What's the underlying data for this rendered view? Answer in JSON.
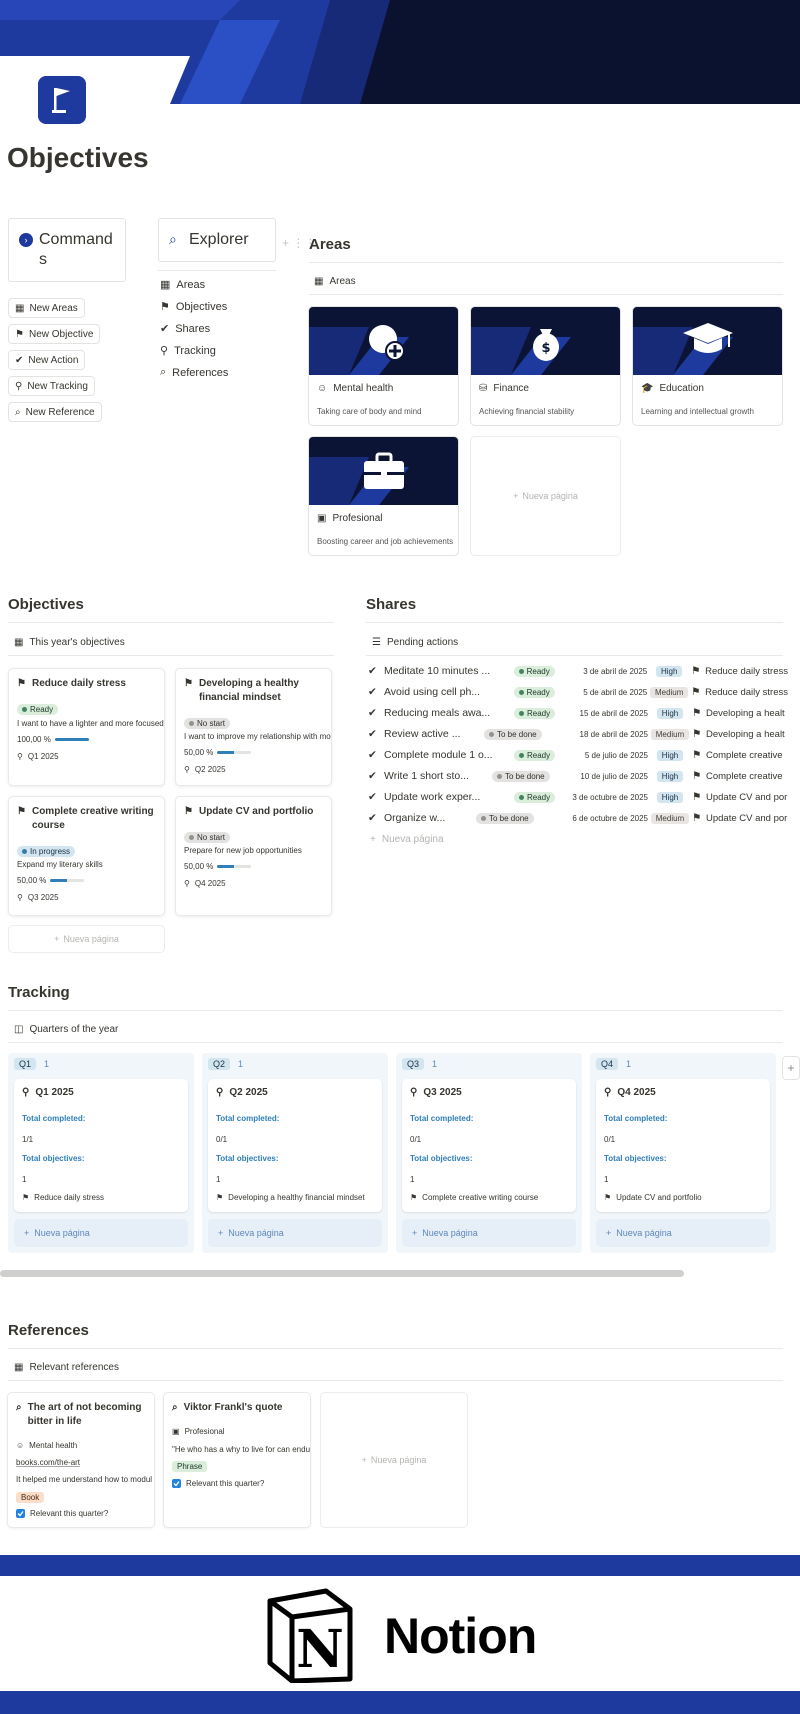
{
  "page": {
    "title": "Objectives"
  },
  "sidebar": {
    "commands_title": "Commands",
    "buttons": [
      {
        "label": "New Areas"
      },
      {
        "label": "New Objective"
      },
      {
        "label": "New Action"
      },
      {
        "label": "New Tracking"
      },
      {
        "label": "New Reference"
      }
    ],
    "explorer_title": "Explorer",
    "nav": [
      {
        "label": "Areas"
      },
      {
        "label": "Objectives"
      },
      {
        "label": "Shares"
      },
      {
        "label": "Tracking"
      },
      {
        "label": "References"
      }
    ]
  },
  "areas": {
    "heading": "Areas",
    "view": "Areas",
    "new_page": "Nueva página",
    "cards": [
      {
        "title": "Mental health",
        "desc": "Taking care of body and mind"
      },
      {
        "title": "Finance",
        "desc": "Achieving financial stability"
      },
      {
        "title": "Education",
        "desc": "Learning and intellectual growth"
      },
      {
        "title": "Profesional",
        "desc": "Boosting career and job achievements"
      }
    ]
  },
  "objectives": {
    "heading": "Objectives",
    "view": "This year's objectives",
    "new_page": "Nueva página",
    "cards": [
      {
        "title": "Reduce daily stress",
        "status": "Ready",
        "desc": "I want to have a lighter and more focused",
        "progress": "100,00 %",
        "progress_value": 1.0,
        "quarter": "Q1 2025"
      },
      {
        "title": "Developing a healthy financial mindset",
        "status": "No start",
        "desc": "I want to improve my relationship with mo",
        "progress": "50,00 %",
        "progress_value": 0.5,
        "quarter": "Q2 2025"
      },
      {
        "title": "Complete creative writing course",
        "status": "In progress",
        "desc": "Expand my literary skills",
        "progress": "50,00 %",
        "progress_value": 0.5,
        "quarter": "Q3 2025"
      },
      {
        "title": "Update CV and portfolio",
        "status": "No start",
        "desc": "Prepare for new job opportunities",
        "progress": "50,00 %",
        "progress_value": 0.5,
        "quarter": "Q4 2025"
      }
    ]
  },
  "shares": {
    "heading": "Shares",
    "view": "Pending actions",
    "new_page": "Nueva página",
    "rows": [
      {
        "name": "Meditate 10 minutes ...",
        "status": "Ready",
        "date": "3 de abril de 2025",
        "priority": "High",
        "objective": "Reduce daily stress"
      },
      {
        "name": "Avoid using cell ph...",
        "status": "Ready",
        "date": "5 de abril de 2025",
        "priority": "Medium",
        "objective": "Reduce daily stress"
      },
      {
        "name": "Reducing meals awa...",
        "status": "Ready",
        "date": "15 de abril de 2025",
        "priority": "High",
        "objective": "Developing a healt"
      },
      {
        "name": "Review active ...",
        "status": "To be done",
        "date": "18 de abril de 2025",
        "priority": "Medium",
        "objective": "Developing a healt"
      },
      {
        "name": "Complete module 1 o...",
        "status": "Ready",
        "date": "5 de julio de 2025",
        "priority": "High",
        "objective": "Complete creative"
      },
      {
        "name": "Write 1 short sto...",
        "status": "To be done",
        "date": "10 de julio de 2025",
        "priority": "High",
        "objective": "Complete creative"
      },
      {
        "name": "Update work exper...",
        "status": "Ready",
        "date": "3 de octubre de 2025",
        "priority": "High",
        "objective": "Update CV and por"
      },
      {
        "name": "Organize w...",
        "status": "To be done",
        "date": "6 de octubre de 2025",
        "priority": "Medium",
        "objective": "Update CV and por"
      }
    ]
  },
  "tracking": {
    "heading": "Tracking",
    "view": "Quarters of the year",
    "completed_label": "Total completed:",
    "objectives_label": "Total objectives:",
    "new_page": "Nueva página",
    "columns": [
      {
        "group": "Q1",
        "count": "1",
        "title": "Q1 2025",
        "completed": "1/1",
        "total": "1",
        "objective": "Reduce daily stress"
      },
      {
        "group": "Q2",
        "count": "1",
        "title": "Q2 2025",
        "completed": "0/1",
        "total": "1",
        "objective": "Developing a healthy financial mindset"
      },
      {
        "group": "Q3",
        "count": "1",
        "title": "Q3 2025",
        "completed": "0/1",
        "total": "1",
        "objective": "Complete creative writing course"
      },
      {
        "group": "Q4",
        "count": "1",
        "title": "Q4 2025",
        "completed": "0/1",
        "total": "1",
        "objective": "Update CV and portfolio"
      }
    ]
  },
  "references": {
    "heading": "References",
    "view": "Relevant references",
    "new_page": "Nueva página",
    "relevant_label": "Relevant this quarter?",
    "cards": [
      {
        "title": "The art of not becoming bitter in life",
        "area": "Mental health",
        "link": "books.com/the-art",
        "desc": "It helped me understand how to modul",
        "tag": "Book"
      },
      {
        "title": "Viktor Frankl's quote",
        "area": "Profesional",
        "desc": "\"He who has a why to live for can endu",
        "tag": "Phrase"
      }
    ]
  },
  "footer": {
    "brand": "Notion"
  },
  "colors": {
    "brand_blue": "#1e3a9e",
    "banner_dark": "#0a1230",
    "link_blue": "#2f7fb8"
  }
}
